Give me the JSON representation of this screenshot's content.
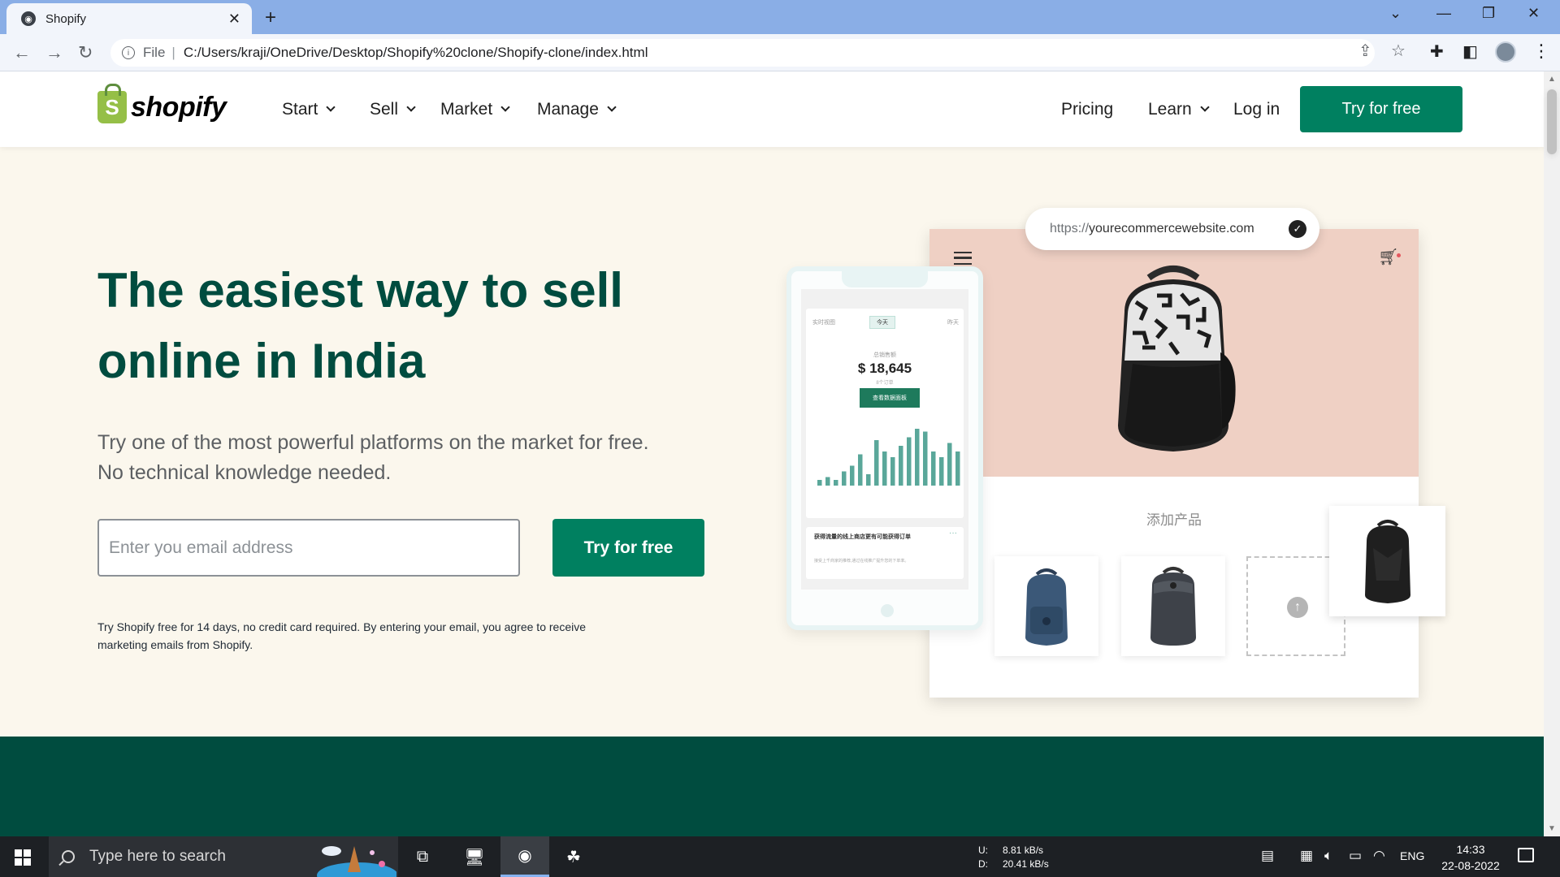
{
  "browser": {
    "tab_title": "Shopify",
    "protocol_label": "File",
    "url": "C:/Users/kraji/OneDrive/Desktop/Shopify%20clone/Shopify-clone/index.html"
  },
  "site": {
    "brand": "shopify",
    "nav_left": [
      "Start",
      "Sell",
      "Market",
      "Manage"
    ],
    "nav_right": {
      "pricing": "Pricing",
      "learn": "Learn",
      "login": "Log in"
    },
    "header_cta": "Try for free"
  },
  "hero": {
    "title_line1": "The easiest way to sell",
    "title_line2": "online in India",
    "subtitle_line1": "Try one of the most powerful platforms on the market for free.",
    "subtitle_line2": "No technical knowledge needed.",
    "email_placeholder": "Enter you email address",
    "cta": "Try for free",
    "disclaimer_line1": "Try Shopify free for 14 days, no credit card required. By entering your email, you agree to receive",
    "disclaimer_line2": "marketing emails from Shopify."
  },
  "illustration": {
    "url_scheme": "https://",
    "url_domain": "yourecommercewebsite.com",
    "add_product_label": "添加产品",
    "dashboard": {
      "tab_realtime": "实时视图",
      "tab_today": "今天",
      "tab_yesterday": "昨天",
      "caption": "总销售额",
      "value": "$ 18,645",
      "orders": "8个订单",
      "button": "查看数据面板",
      "note_title": "获得流量的线上商店更有可能获得订单",
      "note_body": "接受上千商家的推荐,通过在线推广提升您的下单率。",
      "bars": [
        0.1,
        0.15,
        0.1,
        0.25,
        0.35,
        0.55,
        0.2,
        0.8,
        0.6,
        0.5,
        0.7,
        0.85,
        1.0,
        0.95,
        0.6,
        0.5,
        0.75,
        0.6
      ],
      "bar_color": "#5aa79a"
    }
  },
  "taskbar": {
    "search_placeholder": "Type here to search",
    "net_up_label": "U:",
    "net_up": "8.81 kB/s",
    "net_down_label": "D:",
    "net_down": "20.41 kB/s",
    "language": "ENG",
    "time": "14:33",
    "date": "22-08-2022"
  },
  "colors": {
    "brand_green": "#008060",
    "heading_green": "#004c3f",
    "hero_bg": "#fbf7ed",
    "store_banner": "#efd0c4",
    "logo_green": "#95bf47"
  }
}
